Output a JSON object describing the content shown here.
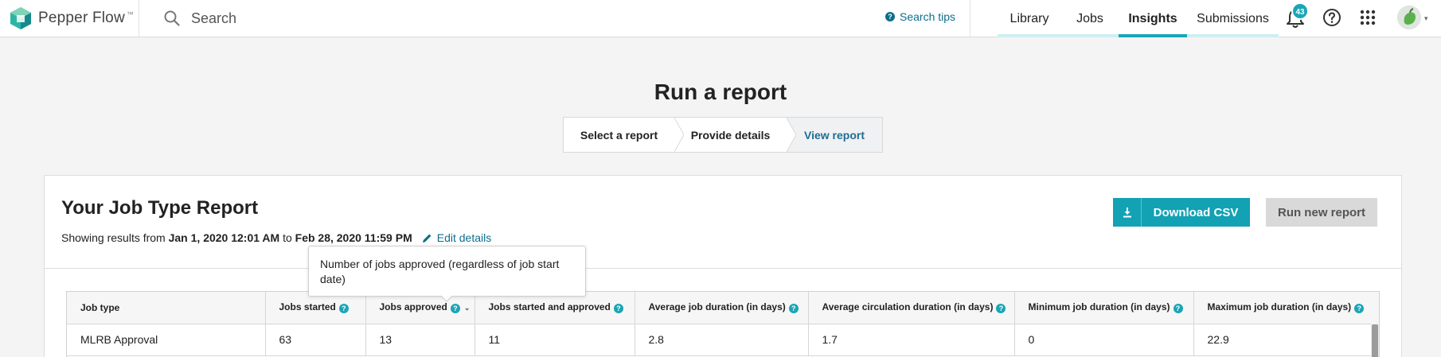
{
  "app": {
    "name": "Pepper Flow",
    "tm": "™"
  },
  "search": {
    "placeholder": "Search",
    "tips_label": "Search tips"
  },
  "nav": [
    {
      "label": "Library",
      "active": false
    },
    {
      "label": "Jobs",
      "active": false
    },
    {
      "label": "Insights",
      "active": true
    },
    {
      "label": "Submissions",
      "active": false
    }
  ],
  "notifications": {
    "count": "43"
  },
  "header": {
    "title": "Run a report",
    "steps": [
      "Select a report",
      "Provide details",
      "View report"
    ],
    "current_step": 3
  },
  "report": {
    "title": "Your Job Type Report",
    "showing_prefix": "Showing results from",
    "from": "Jan 1, 2020 12:01 AM",
    "to_word": "to",
    "to": "Feb 28, 2020 11:59 PM",
    "edit_label": "Edit details",
    "download_label": "Download CSV",
    "run_new_label": "Run new report"
  },
  "tooltip": {
    "text": "Number of jobs approved (regardless of job start date)"
  },
  "table": {
    "columns": [
      "Job type",
      "Jobs started",
      "Jobs approved",
      "Jobs started and approved",
      "Average job duration (in days)",
      "Average circulation duration (in days)",
      "Minimum job duration (in days)",
      "Maximum job duration (in days)"
    ],
    "rows": [
      [
        "MLRB Approval",
        "63",
        "13",
        "11",
        "2.8",
        "1.7",
        "0",
        "22.9"
      ]
    ]
  },
  "colors": {
    "accent": "#13a1b4",
    "link": "#0b6e8c",
    "active_step": "#1d6d94"
  }
}
